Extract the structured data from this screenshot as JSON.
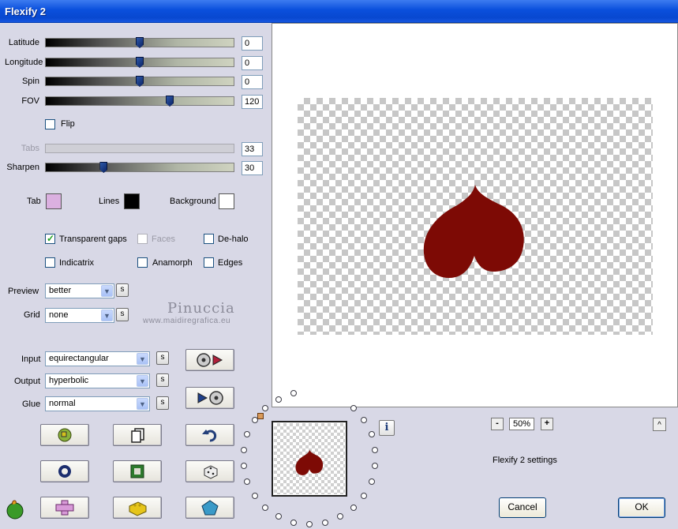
{
  "window": {
    "title": "Flexify 2"
  },
  "sliders": [
    {
      "label": "Latitude",
      "value": "0",
      "level": 0.5,
      "enabled": true
    },
    {
      "label": "Longitude",
      "value": "0",
      "level": 0.5,
      "enabled": true
    },
    {
      "label": "Spin",
      "value": "0",
      "level": 0.5,
      "enabled": true
    },
    {
      "label": "FOV",
      "value": "120",
      "level": 0.667,
      "enabled": true
    },
    {
      "label": "Tabs",
      "value": "33",
      "level": 0.33,
      "enabled": false
    },
    {
      "label": "Sharpen",
      "value": "30",
      "level": 0.3,
      "enabled": true
    }
  ],
  "flip": {
    "label": "Flip",
    "checked": false
  },
  "colors": {
    "tab": {
      "label": "Tab",
      "color": "#dbb0e0"
    },
    "lines": {
      "label": "Lines",
      "color": "#000000"
    },
    "background": {
      "label": "Background",
      "color": "#ffffff"
    }
  },
  "options": {
    "transparent_gaps": {
      "label": "Transparent gaps",
      "checked": true
    },
    "faces": {
      "label": "Faces",
      "checked": false,
      "enabled": false
    },
    "de_halo": {
      "label": "De-halo",
      "checked": false
    },
    "indicatrix": {
      "label": "Indicatrix",
      "checked": false
    },
    "anamorph": {
      "label": "Anamorph",
      "checked": false
    },
    "edges": {
      "label": "Edges",
      "checked": false
    }
  },
  "preview_select": {
    "label": "Preview",
    "value": "better",
    "s": "s"
  },
  "grid_select": {
    "label": "Grid",
    "value": "none",
    "s": "s"
  },
  "watermark": {
    "name": "Pinuccia",
    "url": "www.maidiregrafica.eu"
  },
  "projection": {
    "input": {
      "label": "Input",
      "value": "equirectangular",
      "s": "s"
    },
    "output": {
      "label": "Output",
      "value": "hyperbolic",
      "s": "s"
    },
    "glue": {
      "label": "Glue",
      "value": "normal",
      "s": "s"
    }
  },
  "zoom": {
    "minus": "-",
    "value": "50%",
    "plus": "+"
  },
  "collapse_button": "^",
  "info_button": "i",
  "settings_name": "Flexify 2 settings",
  "buttons": {
    "cancel": "Cancel",
    "ok": "OK"
  },
  "palette": {
    "heart": "#7d0a05",
    "accent": "#0a4fdc"
  }
}
